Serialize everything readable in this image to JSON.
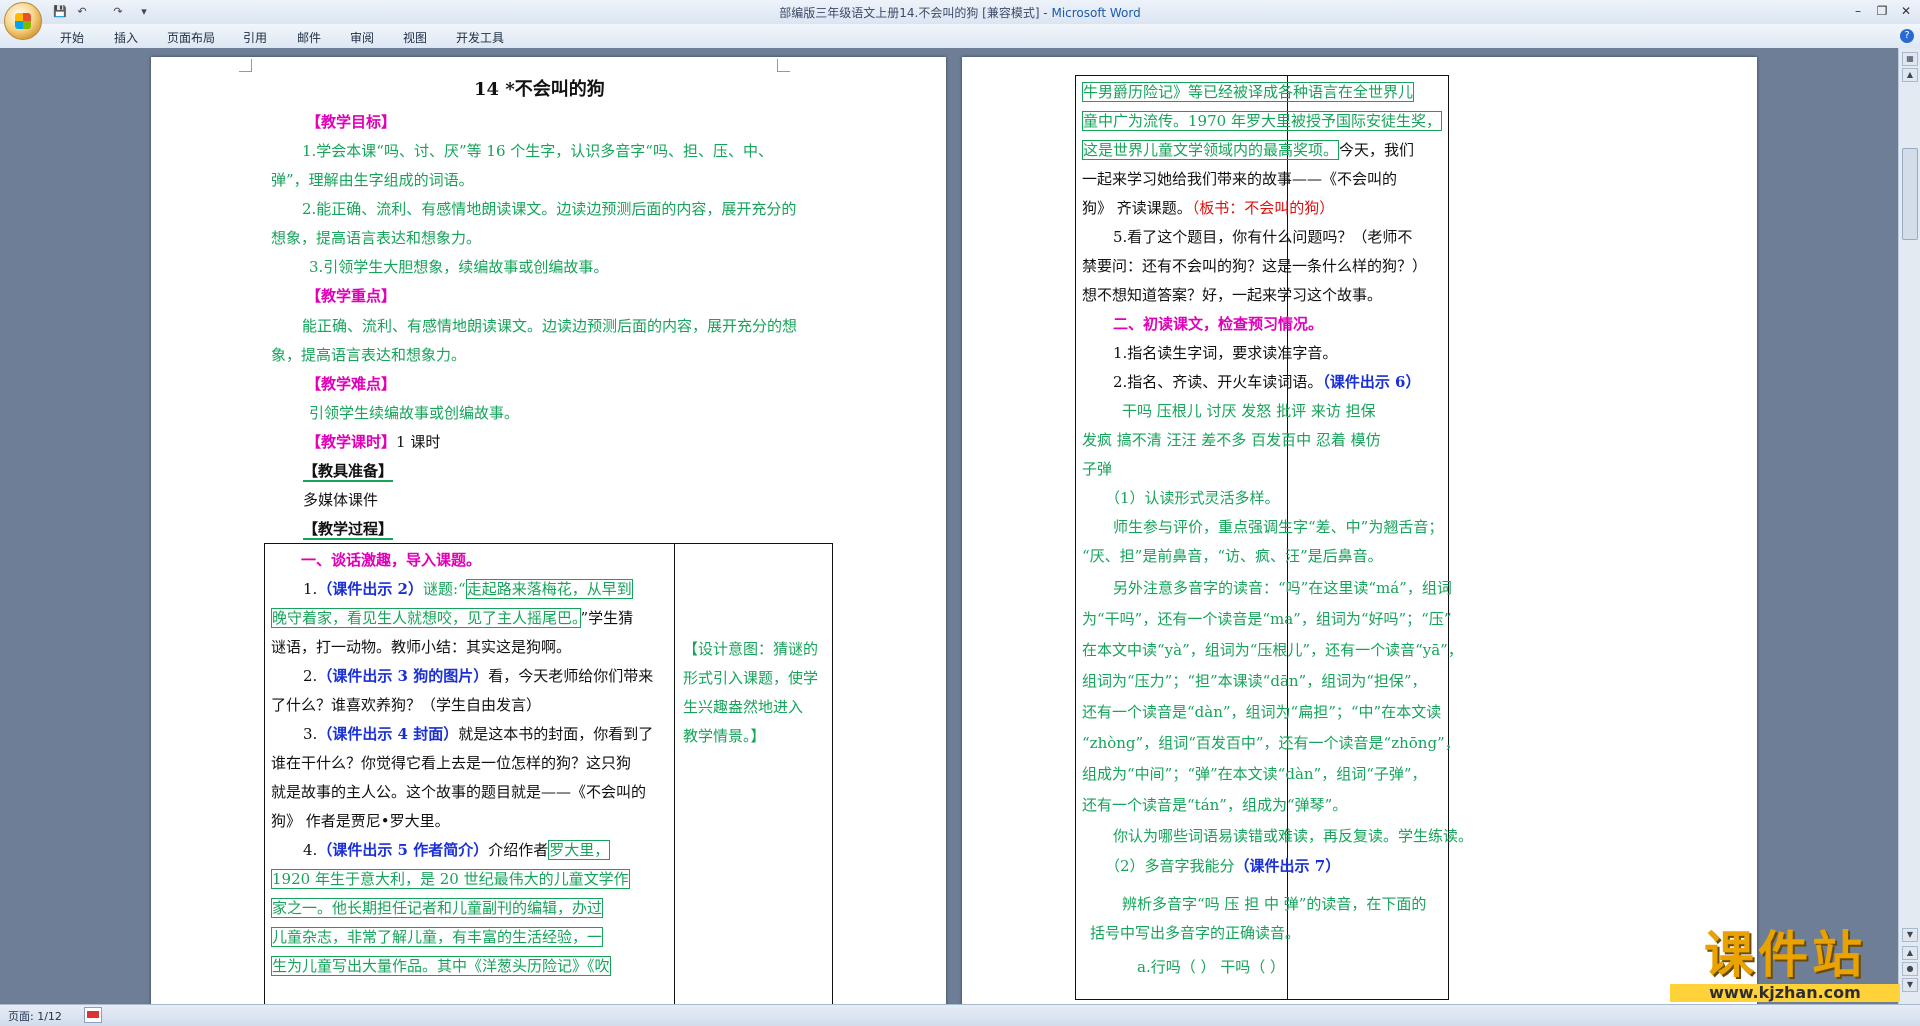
{
  "window": {
    "title": "部编版三年级语文上册14.不会叫的狗 [兼容模式] - ",
    "app_name": "Microsoft Word"
  },
  "ribbon": {
    "tabs": [
      "开始",
      "插入",
      "页面布局",
      "引用",
      "邮件",
      "审阅",
      "视图",
      "开发工具"
    ]
  },
  "status": {
    "page": "页面: 1/12"
  },
  "left_page": {
    "title": "14 *不会叫的狗",
    "goal_heading": "【教学目标】",
    "goal1_a": "1.学会本课“吗、讨、厌”等 16 个生字，认识多音字“吗、担、压、中、",
    "goal1_b": "弹”，理解由生字组成的词语。",
    "goal2_a": "2.能正确、流利、有感情地朗读课文。边读边预测后面的内容，展开充分的",
    "goal2_b": "想象，提高语言表达和想象力。",
    "goal3": "3.引领学生大胆想象，续编故事或创编故事。",
    "key_heading": "【教学重点】",
    "key_a": "能正确、流利、有感情地朗读课文。边读边预测后面的内容，展开充分的想",
    "key_b": "象，提高语言表达和想象力。",
    "diff_heading": "【教学难点】",
    "diff_text": "引领学生续编故事或创编故事。",
    "hours_heading": "【教学课时】",
    "hours_value": "1 课时",
    "prep_heading": "【教具准备】",
    "prep_value": "多媒体课件",
    "process_heading": "【教学过程】",
    "s1_heading": "一、谈话激趣，导入课题。",
    "s1_1_num": "1.",
    "s1_1_cue": "（课件出示 2）",
    "s1_1_pre": "谜题:“",
    "s1_1_q1": "走起路来落梅花，从早到",
    "s1_1_q2": "晚守着家，看见生人就想咬，见了主人摇尾巴。",
    "s1_1_post": "”学生猜",
    "s1_1_c": "谜语，打一动物。教师小结：其实这是狗啊。",
    "s1_2_num": "2.",
    "s1_2_cue": "（课件出示 3 狗的图片）",
    "s1_2_rest": "看，今天老师给你们带来",
    "s1_2_b": "了什么？谁喜欢养狗？（学生自由发言）",
    "s1_3_num": "3.",
    "s1_3_cue": "（课件出示 4 封面）",
    "s1_3_rest": "就是这本书的封面，你看到了",
    "s1_3_b": "谁在干什么？你觉得它看上去是一位怎样的狗？这只狗",
    "s1_3_c": "就是故事的主人公。这个故事的题目就是——《不会叫的",
    "s1_3_d": "狗》 作者是贾尼•罗大里。",
    "s1_4_num": "4.",
    "s1_4_cue": "（课件出示 5 作者简介）",
    "s1_4_rest": "介绍作者",
    "s1_4_a1": "罗大里，",
    "s1_4_b": "1920 年生于意大利，是 20 世纪最伟大的儿童文学作",
    "s1_4_c": "家之一。他长期担任记者和儿童副刊的编辑，办过",
    "s1_4_d": "儿童杂志，非常了解儿童，有丰富的生活经验，一",
    "s1_4_e": "生为儿童写出大量作品。其中《洋葱头历险记》《吹",
    "design_a": "【设计意图：猜谜的",
    "design_b": "形式引入课题，使学",
    "design_c": "生兴趣盎然地进入",
    "design_d": "教学情景。】"
  },
  "right_page": {
    "l1": "牛男爵历险记》等已经被译成各种语言在全世界儿",
    "l2": "童中广为流传。1970 年罗大里被授予国际安徒生奖，",
    "l3_box": "这是世界儿童文学领域内的最高奖项。",
    "l3_rest": "今天，我们",
    "l4": "一起来学习她给我们带来的故事——《不会叫的",
    "l5_a": "狗》 齐读课题。",
    "l5_board": "（板书：不会叫的狗）",
    "l6": "5.看了这个题目，你有什么问题吗？（老师不",
    "l7": "禁要问：还有不会叫的狗？这是一条什么样的狗？）",
    "l8": "想不想知道答案？好，一起来学习这个故事。",
    "s2_heading": "二、初读课文，检查预习情况。",
    "s2_1": "1.指名读生字词，要求读准字音。",
    "s2_2_a": "2.指名、齐读、开火车读词语。",
    "s2_2_cue": "（课件出示 6）",
    "words1": "干吗   压根儿   讨厌   发怒   批评   来访   担保",
    "words2": "发疯   搞不清   汪汪   差不多   百发百中   忍着   模仿",
    "words3": "子弹",
    "sub1": "（1）认读形式灵活多样。",
    "p1_a": "师生参与评价，重点强调生字“差、中”为翘舌音；",
    "p1_b": "“厌、担”是前鼻音，“访、疯、汪”是后鼻音。",
    "p2_a": "另外注意多音字的读音：“吗”在这里读“má”，组词",
    "p2_b": "为“干吗”，还有一个读音是“ma”，组词为“好吗”；“压”",
    "p2_c": "在本文中读“yà”，组词为“压根儿”，还有一个读音“yā”，",
    "p2_d": "组词为“压力”；“担”本课读“dān”，组词为“担保”，",
    "p2_e": "还有一个读音是“dàn”，组词为“扁担”；“中”在本文读",
    "p2_f": "“zhòng”，组词“百发百中”，还有一个读音是“zhōng”，",
    "p2_g": "组成为“中间”；“弹”在本文读“dàn”，组词“子弹”，",
    "p2_h": "还有一个读音是“tán”，组成为“弹琴”。",
    "p3": "你认为哪些词语易读错或难读，再反复读。学生练读。",
    "sub2_a": "（2）多音字我能分",
    "sub2_cue": "（课件出示 7）",
    "p4_a": "辨析多音字“吗 压 担 中 弹”的读音，在下面的",
    "p4_b": "括号中写出多音字的正确读音。",
    "p5": "a.行吗（          ）    干吗（          ）"
  },
  "watermark": {
    "main": "课件站",
    "url": "www.kjzhan.com"
  }
}
